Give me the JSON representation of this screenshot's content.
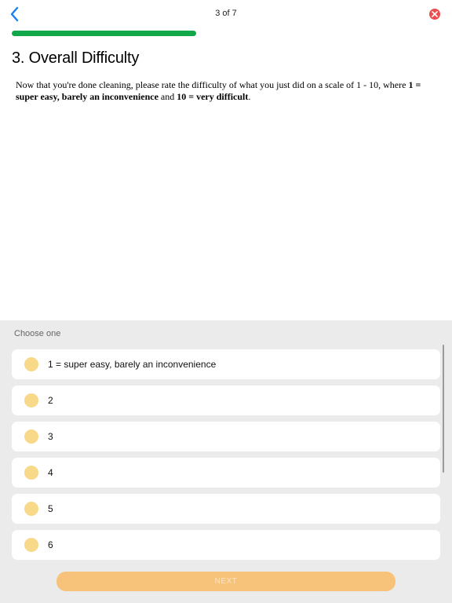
{
  "header": {
    "step_label": "3 of 7",
    "back_icon": "chevron-left-icon",
    "close_icon": "close-circle-icon"
  },
  "progress": {
    "fraction": 0.43,
    "color": "#10a849"
  },
  "question": {
    "title": "3. Overall Difficulty",
    "text_1": "Now that you're done cleaning, please rate the difficulty of what you just did on a scale of 1 - 10, where ",
    "bold_1": "1 = super easy, barely an inconvenience",
    "text_2": " and ",
    "bold_2": "10 = very difficult",
    "text_3": "."
  },
  "answers": {
    "prompt": "Choose one",
    "options": [
      {
        "label": "1 = super easy, barely an inconvenience"
      },
      {
        "label": "2"
      },
      {
        "label": "3"
      },
      {
        "label": "4"
      },
      {
        "label": "5"
      },
      {
        "label": "6"
      }
    ]
  },
  "next_button": {
    "label": "NEXT"
  },
  "colors": {
    "accent_blue": "#1a7ff0",
    "close_red": "#ec4d4d",
    "radio_fill": "#f8d889",
    "next_button": "#f7c27a"
  }
}
